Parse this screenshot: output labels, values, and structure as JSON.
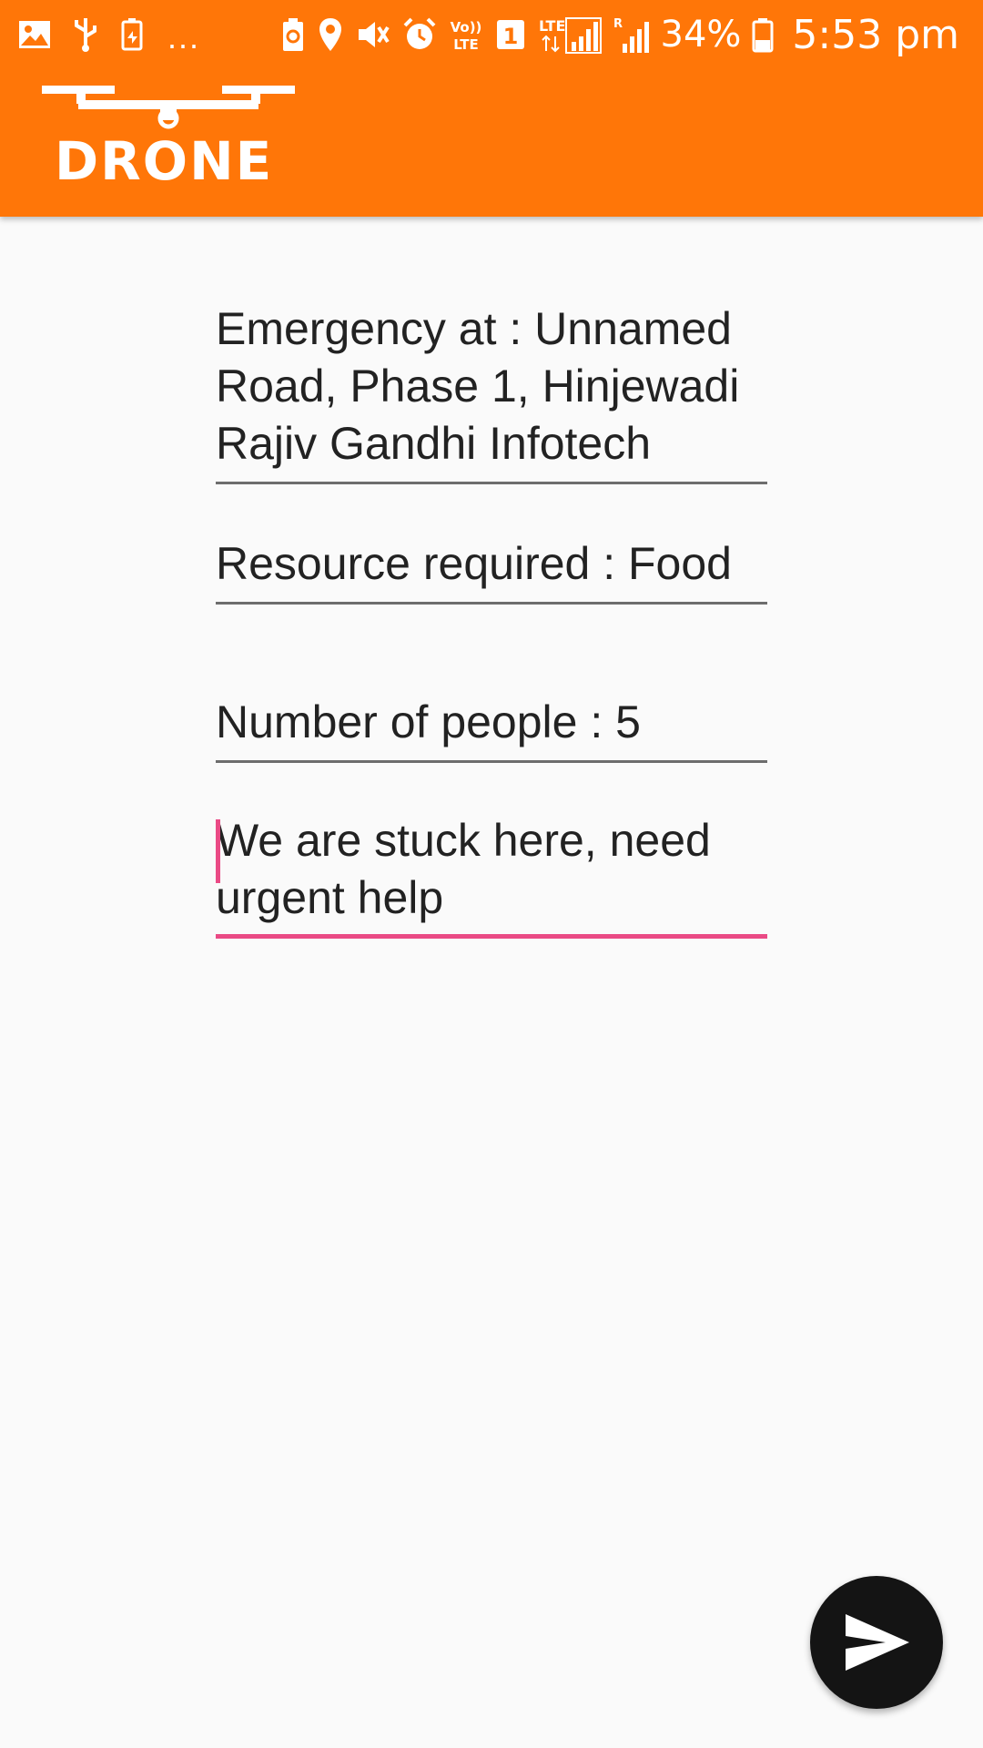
{
  "status_bar": {
    "left_icons": [
      "gallery-icon",
      "usb-icon",
      "battery-saver-icon"
    ],
    "overflow": "...",
    "right_icons": [
      "recycle-icon",
      "location-icon",
      "vibrate-mute-icon",
      "alarm-icon",
      "volte-icon",
      "sim-1-icon",
      "lte-signal-icon",
      "signal-icon"
    ],
    "volte_label": "Vo)) LTE",
    "lte_label": "LTE",
    "sim_label": "1",
    "battery": "34%",
    "time": "5:53 pm"
  },
  "app_bar": {
    "logo_text": "DRONE",
    "color": "#ff7608"
  },
  "form": {
    "emergency": "Emergency at : Unnamed Road, Phase 1, Hinjewadi Rajiv Gandhi Infotech",
    "resource": "Resource required : Food",
    "people": "Number of people : 5",
    "message": "We are stuck here, need urgent help"
  },
  "colors": {
    "accent": "#ea4a85",
    "fab": "#141414",
    "background": "#fafafa"
  },
  "fab": {
    "icon": "send-icon"
  }
}
